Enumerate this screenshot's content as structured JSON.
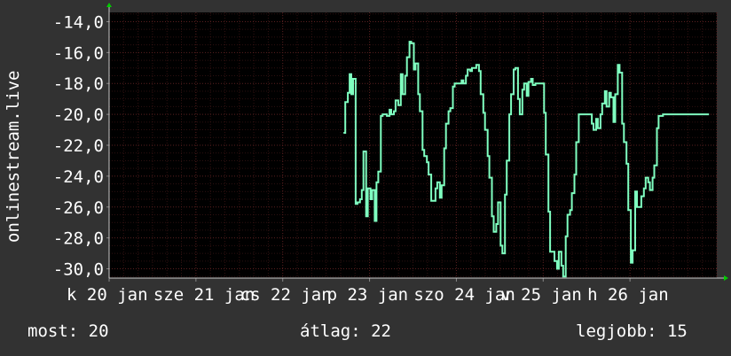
{
  "chart_data": {
    "type": "line",
    "title": "",
    "ylabel": "onlinestream.live",
    "xlabel": "",
    "x_tick_labels": [
      "k 20",
      "jan",
      "sze 21",
      "jan",
      "cs 22",
      "jan",
      "p 23",
      "jan",
      "szo 24",
      "jan",
      "v 25",
      "jan",
      "h 26",
      "jan"
    ],
    "x_tick_labels_b": [
      "",
      "",
      "",
      "",
      "",
      "",
      "",
      "",
      "",
      "",
      "",
      "",
      "",
      ""
    ],
    "x_ticks_raw": [
      "k 20 jan",
      "sze 21 jan",
      "cs 22 jan",
      "p 23 jan",
      "szo 24 jan",
      "v 25 jan",
      "h 26 jan"
    ],
    "y_tick_labels": [
      "-14,0",
      "-16,0",
      "-18,0",
      "-20,0",
      "-22,0",
      "-24,0",
      "-26,0",
      "-28,0",
      "-30,0"
    ],
    "ylim": [
      -30.6,
      -13.4
    ],
    "xlim": [
      0,
      7
    ],
    "grid": true,
    "colors": {
      "background": "#323232",
      "plot_bg": "#000000",
      "grid": "#5a2020",
      "line": "#7fffc0",
      "axis_arrow": "#00cc00"
    },
    "series": [
      {
        "values_x_days": [
          2.7,
          2.72,
          2.75,
          2.77,
          2.79,
          2.81,
          2.84,
          2.86,
          2.89,
          2.91,
          2.93,
          2.96,
          2.98,
          3.01,
          3.03,
          3.06,
          3.08,
          3.1,
          3.13,
          3.15,
          3.18,
          3.2,
          3.23,
          3.25,
          3.28,
          3.3,
          3.33,
          3.36,
          3.38,
          3.41,
          3.43,
          3.46,
          3.48,
          3.51,
          3.53,
          3.56,
          3.58,
          3.61,
          3.63,
          3.66,
          3.68,
          3.71,
          3.73,
          3.76,
          3.78,
          3.81,
          3.83,
          3.86,
          3.88,
          3.91,
          3.93,
          3.96,
          3.98,
          4.01,
          4.03,
          4.06,
          4.08,
          4.11,
          4.13,
          4.16,
          4.18,
          4.21,
          4.23,
          4.26,
          4.28,
          4.31,
          4.33,
          4.36,
          4.38,
          4.41,
          4.43,
          4.46,
          4.48,
          4.51,
          4.53,
          4.56,
          4.58,
          4.61,
          4.63,
          4.66,
          4.68,
          4.71,
          4.73,
          4.76,
          4.78,
          4.81,
          4.83,
          4.86,
          4.88,
          4.91,
          4.93,
          4.96,
          4.98,
          5.01,
          5.03,
          5.06,
          5.08,
          5.11,
          5.13,
          5.16,
          5.18,
          5.21,
          5.23,
          5.26,
          5.28,
          5.31,
          5.33,
          5.36,
          5.38,
          5.41,
          5.43,
          5.46,
          5.48,
          5.51,
          5.53,
          5.56,
          5.58,
          5.61,
          5.63,
          5.66,
          5.68,
          5.71,
          5.73,
          5.76,
          5.78,
          5.81,
          5.83,
          5.86,
          5.88,
          5.91,
          5.93,
          5.96,
          5.98,
          6.01,
          6.03,
          6.06,
          6.08,
          6.11,
          6.13,
          6.16,
          6.18,
          6.21,
          6.23,
          6.26,
          6.28,
          6.31,
          6.33,
          6.36,
          6.38,
          6.41,
          6.43,
          6.46,
          6.48,
          6.51,
          6.53,
          6.56,
          6.58,
          6.61,
          6.63,
          6.66,
          6.68,
          6.71,
          6.73,
          6.76,
          6.78,
          6.81,
          6.83,
          6.86,
          6.88,
          6.91,
          6.93
        ],
        "values": [
          -21.2,
          -19.2,
          -18.6,
          -17.4,
          -18.7,
          -17.7,
          -25.8,
          -25.7,
          -25.5,
          -24.9,
          -22.4,
          -26.6,
          -24.8,
          -25.5,
          -24.9,
          -26.9,
          -24.4,
          -23.7,
          -20.1,
          -20.0,
          -20.0,
          -20.1,
          -19.7,
          -20.0,
          -19.8,
          -19.1,
          -19.4,
          -17.4,
          -18.7,
          -17.5,
          -16.3,
          -15.3,
          -15.4,
          -17.1,
          -16.7,
          -18.7,
          -19.8,
          -22.3,
          -22.7,
          -23.1,
          -23.9,
          -25.6,
          -25.6,
          -24.8,
          -24.4,
          -25.4,
          -24.6,
          -22.2,
          -20.6,
          -19.8,
          -19.6,
          -18.2,
          -18.0,
          -18.0,
          -18.0,
          -17.8,
          -18.0,
          -17.5,
          -17.1,
          -17.2,
          -17.0,
          -17.0,
          -16.8,
          -17.2,
          -18.7,
          -19.9,
          -21.0,
          -22.7,
          -24.1,
          -26.6,
          -27.6,
          -27.1,
          -25.7,
          -28.5,
          -29.0,
          -25.2,
          -23.0,
          -20.0,
          -18.7,
          -17.1,
          -17.0,
          -19.0,
          -20.0,
          -18.4,
          -18.0,
          -18.8,
          -17.9,
          -17.7,
          -18.1,
          -18.0,
          -18.0,
          -18.0,
          -18.0,
          -19.9,
          -22.6,
          -26.3,
          -28.9,
          -28.9,
          -29.5,
          -30.0,
          -28.9,
          -29.8,
          -30.5,
          -27.9,
          -26.5,
          -26.2,
          -25.1,
          -23.9,
          -21.8,
          -20.0,
          -20.0,
          -20.0,
          -20.0,
          -20.0,
          -20.0,
          -20.6,
          -21.0,
          -20.3,
          -20.9,
          -20.0,
          -19.3,
          -18.5,
          -19.5,
          -18.6,
          -18.9,
          -20.5,
          -18.7,
          -16.8,
          -17.3,
          -20.6,
          -21.8,
          -23.2,
          -26.2,
          -29.6,
          -28.8,
          -25.0,
          -26.0,
          -26.0,
          -25.3,
          -24.8,
          -24.1,
          -24.4,
          -24.9,
          -24.1,
          -23.3,
          -20.9,
          -20.1,
          -20.1,
          -20.0,
          -20.0,
          -20.0,
          -20.0,
          -20.0,
          -20.0,
          -20.0,
          -20.0,
          -20.0,
          -20.0,
          -20.0,
          -20.0,
          -20.0,
          -20.0,
          -20.0,
          -20.0,
          -20.0,
          -20.0,
          -20.0,
          -20.0,
          -20.0,
          -20.0
        ]
      }
    ]
  },
  "footer": {
    "current": "most: 20",
    "average": "átlag: 22",
    "best": "legjobb: 15"
  }
}
